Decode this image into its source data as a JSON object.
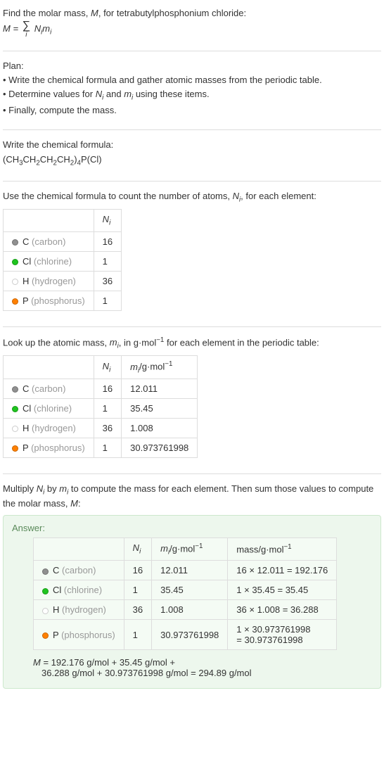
{
  "intro": {
    "line1_pre": "Find the molar mass, ",
    "line1_M": "M",
    "line1_post": ", for tetrabutylphosphonium chloride:",
    "eq_lhs": "M = ",
    "eq_rhs_N": "N",
    "eq_rhs_m": "m",
    "eq_sub": "i"
  },
  "plan": {
    "title": "Plan:",
    "b1": "• Write the chemical formula and gather atomic masses from the periodic table.",
    "b2_pre": "• Determine values for ",
    "b2_N": "N",
    "b2_and": " and ",
    "b2_m": "m",
    "b2_post": " using these items.",
    "b3": "• Finally, compute the mass."
  },
  "sec1": {
    "title": "Write the chemical formula:",
    "formula_pre": "(CH",
    "formula": "(CH3CH2CH2CH2)4P(Cl)"
  },
  "sec2": {
    "title_pre": "Use the chemical formula to count the number of atoms, ",
    "title_N": "N",
    "title_sub": "i",
    "title_post": ", for each element:",
    "head_N": "N",
    "rows": [
      {
        "sym": "C",
        "name": "(carbon)",
        "n": "16",
        "dot": "c"
      },
      {
        "sym": "Cl",
        "name": "(chlorine)",
        "n": "1",
        "dot": "cl"
      },
      {
        "sym": "H",
        "name": "(hydrogen)",
        "n": "36",
        "dot": "h"
      },
      {
        "sym": "P",
        "name": "(phosphorus)",
        "n": "1",
        "dot": "p"
      }
    ]
  },
  "sec3": {
    "title_pre": "Look up the atomic mass, ",
    "title_m": "m",
    "title_sub": "i",
    "title_mid": ", in g·mol",
    "title_sup": "−1",
    "title_post": " for each element in the periodic table:",
    "head_N": "N",
    "head_m_pre": "m",
    "head_m_unit": "/g·mol",
    "rows": [
      {
        "sym": "C",
        "name": "(carbon)",
        "n": "16",
        "m": "12.011",
        "dot": "c"
      },
      {
        "sym": "Cl",
        "name": "(chlorine)",
        "n": "1",
        "m": "35.45",
        "dot": "cl"
      },
      {
        "sym": "H",
        "name": "(hydrogen)",
        "n": "36",
        "m": "1.008",
        "dot": "h"
      },
      {
        "sym": "P",
        "name": "(phosphorus)",
        "n": "1",
        "m": "30.973761998",
        "dot": "p"
      }
    ]
  },
  "sec4": {
    "line_pre": "Multiply ",
    "N": "N",
    "by": " by ",
    "m": "m",
    "line_post": " to compute the mass for each element. Then sum those values to compute the molar mass, ",
    "M": "M",
    "colon": ":"
  },
  "answer": {
    "title": "Answer:",
    "head_N": "N",
    "head_m_pre": "m",
    "head_unit": "/g·mol",
    "head_mass": "mass/g·mol",
    "rows": [
      {
        "sym": "C",
        "name": "(carbon)",
        "n": "16",
        "m": "12.011",
        "mass": "16 × 12.011 = 192.176",
        "dot": "c"
      },
      {
        "sym": "Cl",
        "name": "(chlorine)",
        "n": "1",
        "m": "35.45",
        "mass": "1 × 35.45 = 35.45",
        "dot": "cl"
      },
      {
        "sym": "H",
        "name": "(hydrogen)",
        "n": "36",
        "m": "1.008",
        "mass": "36 × 1.008 = 36.288",
        "dot": "h"
      },
      {
        "sym": "P",
        "name": "(phosphorus)",
        "n": "1",
        "m": "30.973761998",
        "mass1": "1 × 30.973761998",
        "mass2": "= 30.973761998",
        "dot": "p"
      }
    ],
    "final_M": "M",
    "final_eq": " = 192.176 g/mol + 35.45 g/mol +",
    "final_line2": "36.288 g/mol + 30.973761998 g/mol = 294.89 g/mol"
  }
}
